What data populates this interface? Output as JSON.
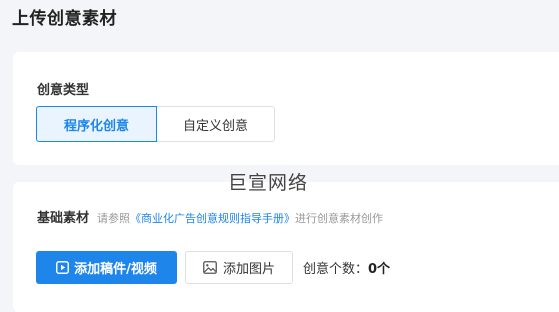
{
  "page": {
    "title": "上传创意素材"
  },
  "creative_type": {
    "label": "创意类型",
    "options": [
      {
        "label": "程序化创意",
        "selected": true
      },
      {
        "label": "自定义创意",
        "selected": false
      }
    ]
  },
  "watermark": "巨宣网络",
  "basic_material": {
    "label": "基础素材",
    "hint_prefix": "请参照",
    "hint_link": "《商业化广告创意规则指导手册》",
    "hint_suffix": "进行创意素材创作",
    "add_video_button": "添加稿件/视频",
    "add_image_button": "添加图片",
    "count_label": "创意个数：",
    "count_value": "0个"
  },
  "colors": {
    "accent": "#1e85ea",
    "background": "#f4f5f8"
  },
  "icons": {
    "add_video": "play-box-icon",
    "add_image": "image-icon"
  }
}
